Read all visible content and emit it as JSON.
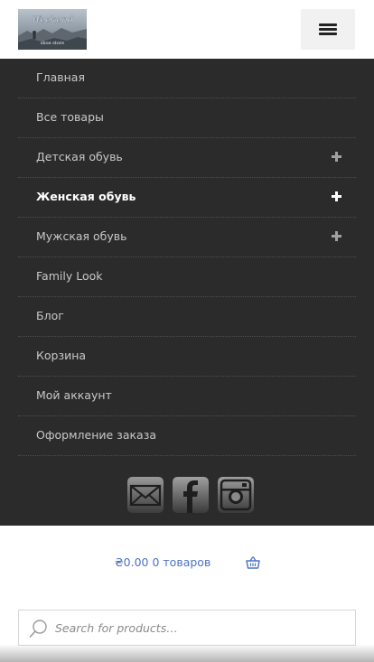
{
  "header": {
    "logo_alt": "Weekend",
    "menu_toggle_icon": "hamburger-icon"
  },
  "nav": {
    "items": [
      {
        "label": "Главная",
        "has_submenu": false,
        "active": false
      },
      {
        "label": "Все товары",
        "has_submenu": false,
        "active": false
      },
      {
        "label": "Детская обувь",
        "has_submenu": true,
        "active": false
      },
      {
        "label": "Женская обувь",
        "has_submenu": true,
        "active": true
      },
      {
        "label": "Мужская обувь",
        "has_submenu": true,
        "active": false
      },
      {
        "label": "Family Look",
        "has_submenu": false,
        "active": false
      },
      {
        "label": "Блог",
        "has_submenu": false,
        "active": false
      },
      {
        "label": "Корзина",
        "has_submenu": false,
        "active": false
      },
      {
        "label": "Мой аккаунт",
        "has_submenu": false,
        "active": false
      },
      {
        "label": "Оформление заказа",
        "has_submenu": false,
        "active": false
      }
    ],
    "social": [
      "email-icon",
      "facebook-icon",
      "instagram-icon"
    ]
  },
  "cart": {
    "label": "₴0.00 0 товаров",
    "icon": "basket-icon"
  },
  "search": {
    "placeholder": "Search for products…",
    "value": ""
  },
  "colors": {
    "nav_bg": "#2b2b2b",
    "link": "#4a73c6",
    "nav_text": "#c8c8c8",
    "nav_active": "#ffffff"
  }
}
